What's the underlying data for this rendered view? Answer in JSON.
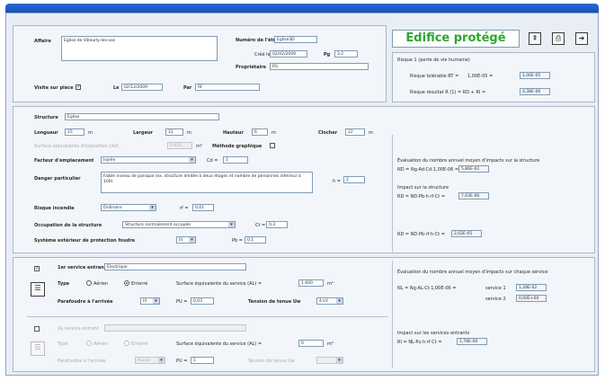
{
  "app": {
    "title_status": "Edifice protégé"
  },
  "header": {
    "affaire_label": "Affaire",
    "affaire_value": "Eglise de Villeurly-les-vas",
    "numero_label": "Numéro de l'étude",
    "numero_value": "Eglise3D",
    "cree_label": "Créé le",
    "cree_value": "02/02/2009",
    "pg_label": "Pg",
    "pg_value": "3.2",
    "proprietaire_label": "Propriétaire",
    "proprietaire_value": "RS",
    "visite_label": "Visite sur place",
    "visite_checked": true,
    "le_label": "Le",
    "le_value": "02/12/2009",
    "par_label": "Par",
    "par_value": "RF"
  },
  "risk_summary": {
    "title": "Risque 1 (perte de vie humaine)",
    "row1_label": "Risque tolérable RT =",
    "row1_value_text": "1,00E-05 =",
    "row1_value": "1,00E-05",
    "row2_label": "Risque résultat R (1) = RD + RI =",
    "row2_value": "4,38E-06"
  },
  "structure": {
    "structure_label": "Structure",
    "structure_value": "Eglise",
    "longueur_label": "Longueur",
    "longueur_value": "25",
    "longueur_unit": "m",
    "largeur_label": "Largeur",
    "largeur_value": "12",
    "largeur_unit": "m",
    "hauteur_label": "Hauteur",
    "hauteur_value": "6",
    "hauteur_unit": "m",
    "clocher_label": "Clocher",
    "clocher_value": "22",
    "clocher_unit": "m",
    "surface_label": "Surface équivalente d'exposition (Ad)",
    "surface_value": "5 933",
    "surface_unit": "m²",
    "methode_label": "Méthode graphique",
    "facteur_label": "Facteur d'emplacement",
    "facteur_value": "Isolée",
    "cd_label": "Cd =",
    "cd_value": "1",
    "dangers_label": "Danger particulier",
    "dangers_value": "Faible niveau de panique (ex. structure limitée à deux étages et nombre de personnes inférieur à 100)",
    "h_label": "h =",
    "h_value": "2",
    "risque_label": "Risque incendie",
    "risque_value": "Ordinaire",
    "rf_label": "rf =",
    "rf_value": "0,01",
    "occupation_label": "Occupation de la structure",
    "occupation_value": "Structure normalement occupée",
    "ct_label": "Ct =",
    "ct_value": "0,3",
    "systeme_label": "Système extérieur de protection foudre",
    "systeme_value": "III",
    "pb_label": "Pb =",
    "pb_value": "0,1"
  },
  "evaluation": {
    "nd_title": "Évaluation du nombre annuel moyen d'impacts sur la structure",
    "nd_formula": "ND = Ng·Ad·Cd·1,00E-06 =",
    "nd_value": "5,86E-02",
    "rd_title": "Impact sur la structure",
    "rd_formula": "RD = ND·Pb·h·rf·Ct =",
    "rd_value": "7,03E-06",
    "ri_formula": "RD = ND·Pb·rf·h·Ct =",
    "ri_value": "2,02E-05"
  },
  "service1": {
    "title_label": "1er service entrant",
    "title_value": "Électrique",
    "type_label": "Type",
    "type_aerien": "Aérien",
    "type_enterre": "Enterré",
    "surface_label": "Surface équivalente du service (AL) =",
    "surface_value": "1 600",
    "surface_unit": "m²",
    "parafoudre_label": "Parafoudre à l'arrivée",
    "parafoudre_value": "III",
    "pu_label": "PU =",
    "pu_value": "0,03",
    "tension_label": "Tension de tenue Uw",
    "tension_value": "4 kV"
  },
  "service2": {
    "title_label": "2e service entrant",
    "title_value": "",
    "type_label": "Type",
    "type_aerien": "Aérien",
    "type_enterre": "Enterré",
    "surface_label": "Surface équivalente du service (AL) =",
    "surface_value": "0",
    "surface_unit": "m²",
    "parafoudre_label": "Parafoudre à l'arrivée",
    "parafoudre_value": "Aucun",
    "pu_label": "PU =",
    "pu_value": "1",
    "tension_label": "Tension de tenue Uw",
    "tension_value": ""
  },
  "services_eval": {
    "nl_title": "Évaluation du nombre annuel moyen d'impacts sur chaque service",
    "nl_formula": "NL = Ng·AL·Ct·1,00E-06 =",
    "s1_label": "service 1",
    "s1_value": "1,28E-02",
    "s2_label": "service 2",
    "s2_value": "0,00E+00",
    "impact_title": "Impact sur les services entrants",
    "impact_formula": "RI = NL·Pu·h·rf·Ct =",
    "impact_value": "1,78E-06"
  },
  "icons": {
    "help": "help-icon",
    "print": "printer-icon",
    "exit": "exit-icon"
  }
}
